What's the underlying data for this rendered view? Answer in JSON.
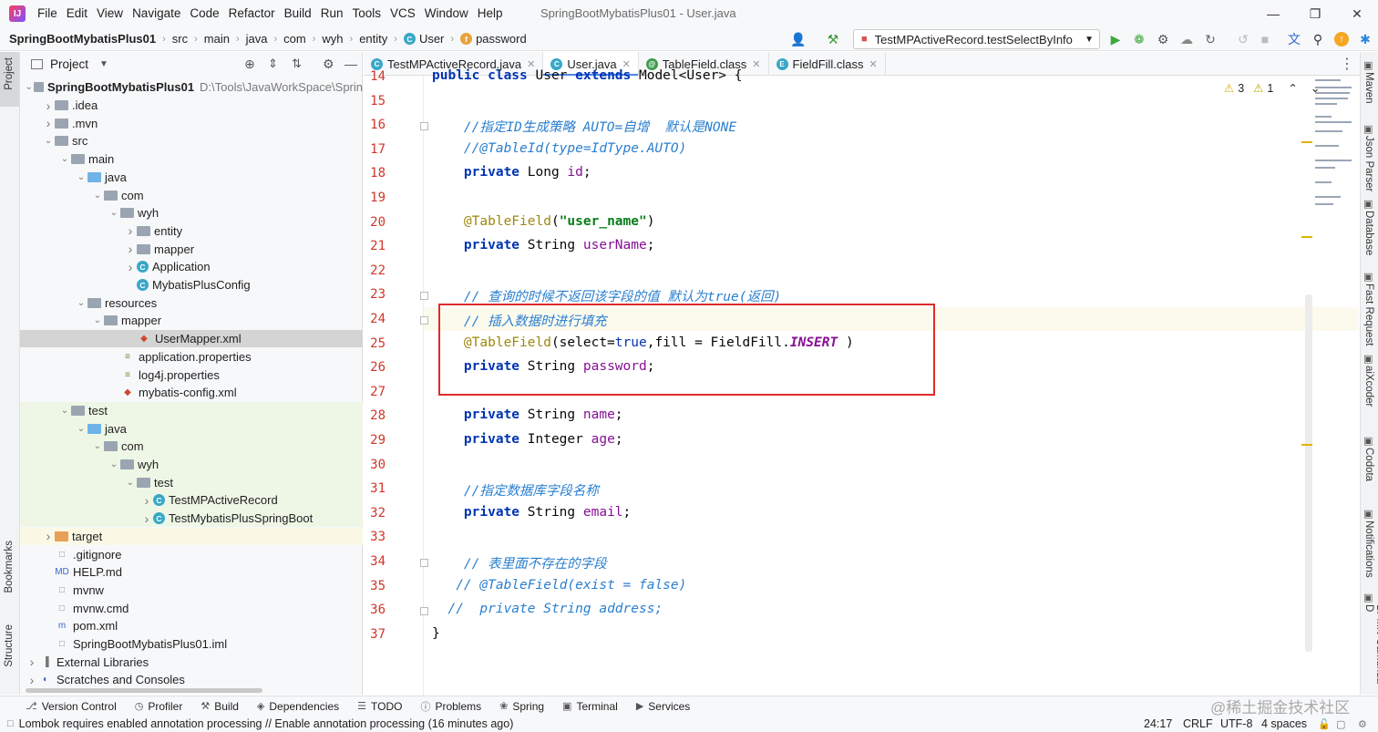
{
  "menu": {
    "items": [
      "File",
      "Edit",
      "View",
      "Navigate",
      "Code",
      "Refactor",
      "Build",
      "Run",
      "Tools",
      "VCS",
      "Window",
      "Help"
    ],
    "window_title": "SpringBootMybatisPlus01 - User.java"
  },
  "breadcrumb": {
    "items": [
      "SpringBootMybatisPlus01",
      "src",
      "main",
      "java",
      "com",
      "wyh",
      "entity",
      "User",
      "password"
    ]
  },
  "toolbar": {
    "run_config": "TestMPActiveRecord.testSelectByInfo"
  },
  "project": {
    "title": "Project",
    "tree": [
      {
        "label": "SpringBootMybatisPlus01",
        "extra": "D:\\Tools\\JavaWorkSpace\\Sprin",
        "depth": 0,
        "arrow": "v",
        "icon": "folder",
        "bold": true
      },
      {
        "label": ".idea",
        "depth": 1,
        "arrow": ">",
        "icon": "folder"
      },
      {
        "label": ".mvn",
        "depth": 1,
        "arrow": ">",
        "icon": "folder"
      },
      {
        "label": "src",
        "depth": 1,
        "arrow": "v",
        "icon": "folder"
      },
      {
        "label": "main",
        "depth": 2,
        "arrow": "v",
        "icon": "folder"
      },
      {
        "label": "java",
        "depth": 3,
        "arrow": "v",
        "icon": "folder-blue"
      },
      {
        "label": "com",
        "depth": 4,
        "arrow": "v",
        "icon": "folder"
      },
      {
        "label": "wyh",
        "depth": 5,
        "arrow": "v",
        "icon": "folder"
      },
      {
        "label": "entity",
        "depth": 6,
        "arrow": ">",
        "icon": "folder"
      },
      {
        "label": "mapper",
        "depth": 6,
        "arrow": ">",
        "icon": "folder"
      },
      {
        "label": "Application",
        "depth": 6,
        "arrow": ">",
        "icon": "class"
      },
      {
        "label": "MybatisPlusConfig",
        "depth": 6,
        "arrow": "",
        "icon": "class"
      },
      {
        "label": "resources",
        "depth": 3,
        "arrow": "v",
        "icon": "folder"
      },
      {
        "label": "mapper",
        "depth": 4,
        "arrow": "v",
        "icon": "folder"
      },
      {
        "label": "UserMapper.xml",
        "depth": 6,
        "arrow": "",
        "icon": "xml",
        "selected": true
      },
      {
        "label": "application.properties",
        "depth": 5,
        "arrow": "",
        "icon": "props"
      },
      {
        "label": "log4j.properties",
        "depth": 5,
        "arrow": "",
        "icon": "props"
      },
      {
        "label": "mybatis-config.xml",
        "depth": 5,
        "arrow": "",
        "icon": "xml"
      },
      {
        "label": "test",
        "depth": 2,
        "arrow": "v",
        "icon": "folder",
        "green": true
      },
      {
        "label": "java",
        "depth": 3,
        "arrow": "v",
        "icon": "folder-blue",
        "green": true
      },
      {
        "label": "com",
        "depth": 4,
        "arrow": "v",
        "icon": "folder",
        "green": true
      },
      {
        "label": "wyh",
        "depth": 5,
        "arrow": "v",
        "icon": "folder",
        "green": true
      },
      {
        "label": "test",
        "depth": 6,
        "arrow": "v",
        "icon": "folder",
        "green": true
      },
      {
        "label": "TestMPActiveRecord",
        "depth": 7,
        "arrow": ">",
        "icon": "class",
        "green": true
      },
      {
        "label": "TestMybatisPlusSpringBoot",
        "depth": 7,
        "arrow": ">",
        "icon": "class",
        "green": true
      },
      {
        "label": "target",
        "depth": 1,
        "arrow": ">",
        "icon": "folder-orange",
        "yellow": true
      },
      {
        "label": ".gitignore",
        "depth": 1,
        "arrow": "",
        "icon": "file"
      },
      {
        "label": "HELP.md",
        "depth": 1,
        "arrow": "",
        "icon": "md"
      },
      {
        "label": "mvnw",
        "depth": 1,
        "arrow": "",
        "icon": "file"
      },
      {
        "label": "mvnw.cmd",
        "depth": 1,
        "arrow": "",
        "icon": "file"
      },
      {
        "label": "pom.xml",
        "depth": 1,
        "arrow": "",
        "icon": "maven"
      },
      {
        "label": "SpringBootMybatisPlus01.iml",
        "depth": 1,
        "arrow": "",
        "icon": "file"
      },
      {
        "label": "External Libraries",
        "depth": 0,
        "arrow": ">",
        "icon": "lib"
      },
      {
        "label": "Scratches and Consoles",
        "depth": 0,
        "arrow": ">",
        "icon": "scratch"
      }
    ]
  },
  "tabs": [
    {
      "label": "TestMPActiveRecord.java",
      "icon": "C",
      "color": "#38a8c8",
      "active": false
    },
    {
      "label": "User.java",
      "icon": "C",
      "color": "#38a8c8",
      "active": true
    },
    {
      "label": "TableField.class",
      "icon": "@",
      "color": "#3f9b4a",
      "active": false
    },
    {
      "label": "FieldFill.class",
      "icon": "E",
      "color": "#38a8c8",
      "active": false
    }
  ],
  "editor": {
    "warnings": "3",
    "weak_warnings": "1",
    "lines": [
      {
        "n": "14",
        "html": "<span class='kw'>public class</span> User <span class='kw'>extends</span> Model&lt;User&gt; {"
      },
      {
        "n": "15",
        "html": ""
      },
      {
        "n": "16",
        "html": "    <span class='cm'>//指定ID生成策略 AUTO=自增  默认是NONE</span>"
      },
      {
        "n": "17",
        "html": "    <span class='cm'>//@TableId(type=IdType.AUTO)</span>"
      },
      {
        "n": "18",
        "html": "    <span class='kw'>private</span> Long <span class='fd'>id</span>;"
      },
      {
        "n": "19",
        "html": ""
      },
      {
        "n": "20",
        "html": "    <span class='an'>@TableField</span>(<span class='st'>\"user_name\"</span>)"
      },
      {
        "n": "21",
        "html": "    <span class='kw'>private</span> String <span class='fd'>userName</span>;"
      },
      {
        "n": "22",
        "html": ""
      },
      {
        "n": "23",
        "html": "    <span class='cm'>// 查询的时候不返回该字段的值 默认为true(返回)</span>"
      },
      {
        "n": "24",
        "html": "    <span class='cm'>// 插入数据时进行填充</span>"
      },
      {
        "n": "25",
        "html": "    <span class='an'>@TableField</span>(select=<span class='bool'>true</span>,fill = FieldFill.<span class='en'>INSERT</span> )"
      },
      {
        "n": "26",
        "html": "    <span class='kw'>private</span> String <span class='fd'>password</span>;"
      },
      {
        "n": "27",
        "html": ""
      },
      {
        "n": "28",
        "html": "    <span class='kw'>private</span> String <span class='fd'>name</span>;"
      },
      {
        "n": "29",
        "html": "    <span class='kw'>private</span> Integer <span class='fd'>age</span>;"
      },
      {
        "n": "30",
        "html": ""
      },
      {
        "n": "31",
        "html": "    <span class='cm'>//指定数据库字段名称</span>"
      },
      {
        "n": "32",
        "html": "    <span class='kw'>private</span> String <span class='fd'>email</span>;"
      },
      {
        "n": "33",
        "html": ""
      },
      {
        "n": "34",
        "html": "    <span class='cm'>// 表里面不存在的字段</span>"
      },
      {
        "n": "35",
        "html": "   <span class='cm'>// @TableField(exist = false)</span>"
      },
      {
        "n": "36",
        "html": "  <span class='cm'>//  private String address;</span>"
      },
      {
        "n": "37",
        "html": "}"
      }
    ]
  },
  "left_strip": {
    "project": "Project",
    "bookmarks": "Bookmarks",
    "structure": "Structure"
  },
  "right_strip": [
    "Maven",
    "Json Parser",
    "Database",
    "Fast Request",
    "aiXcoder",
    "Codota",
    "Notifications",
    "BPMN-Camunda-D"
  ],
  "bottom_tools": [
    "Version Control",
    "Profiler",
    "Build",
    "Dependencies",
    "TODO",
    "Problems",
    "Spring",
    "Terminal",
    "Services"
  ],
  "status": {
    "message": "Lombok requires enabled annotation processing // Enable annotation processing (16 minutes ago)",
    "position": "24:17",
    "line_sep": "CRLF",
    "encoding": "UTF-8",
    "indent": "4 spaces"
  },
  "watermark": "@稀土掘金技术社区"
}
